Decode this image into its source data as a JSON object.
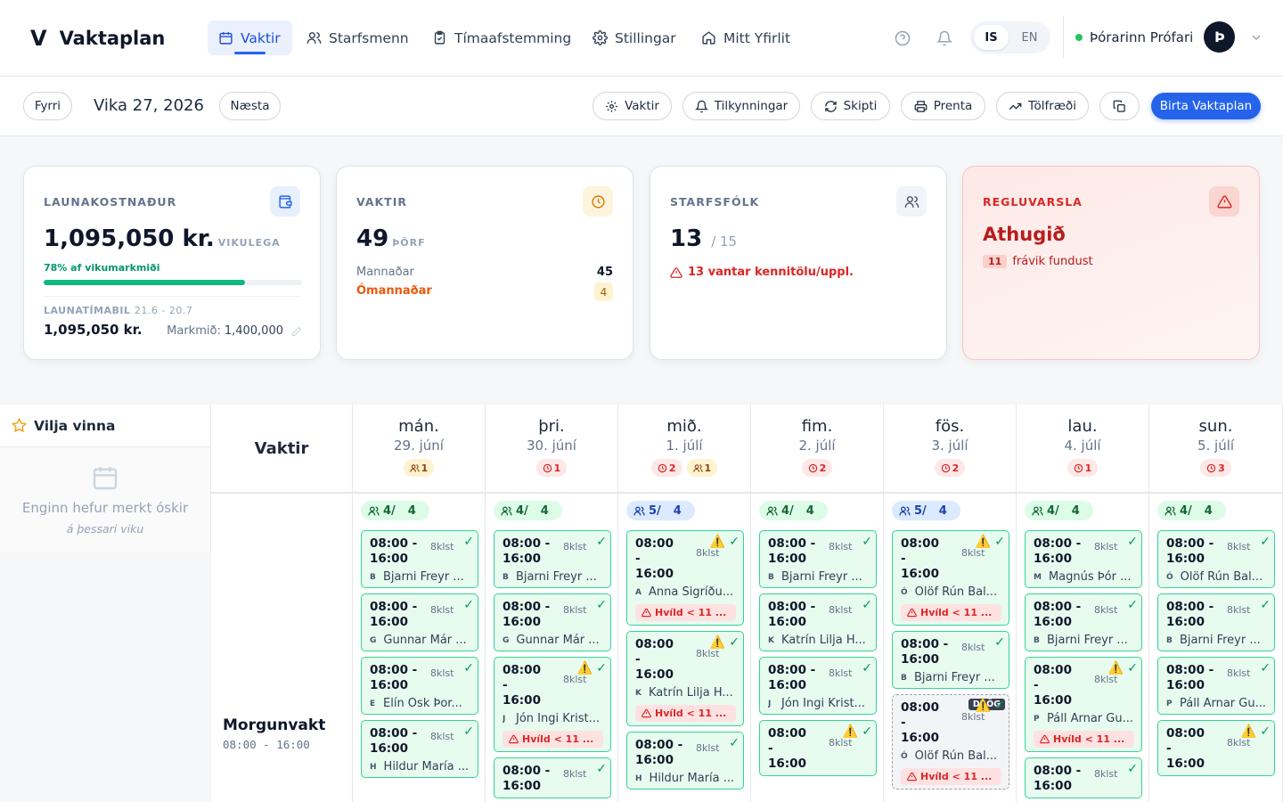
{
  "app": {
    "logo_mark": "V",
    "title": "Vaktaplan"
  },
  "nav": [
    {
      "label": "Vaktir",
      "icon": "calendar-icon",
      "active": true
    },
    {
      "label": "Starfsmenn",
      "icon": "users-icon",
      "active": false
    },
    {
      "label": "Tímaafstemming",
      "icon": "clipboard-check-icon",
      "active": false
    },
    {
      "label": "Stillingar",
      "icon": "gear-icon",
      "active": false
    },
    {
      "label": "Mitt Yfirlit",
      "icon": "home-icon",
      "active": false
    }
  ],
  "lang": {
    "is": "IS",
    "en": "EN"
  },
  "user": {
    "name": "Þórarinn Prófari",
    "initial": "Þ"
  },
  "toolbar": {
    "prev": "Fyrri",
    "week": "Vika 27, 2026",
    "next": "Næsta",
    "shifts": "Vaktir",
    "notifications": "Tilkynningar",
    "swaps": "Skipti",
    "print": "Prenta",
    "stats": "Tölfræði",
    "publish": "Birta Vaktaplan"
  },
  "cards": {
    "payroll": {
      "title": "LAUNAKOSTNAÐUR",
      "amount": "1,095,050 kr.",
      "unit": "VIKULEGA",
      "target_pct_text": "78% af vikumarkmiði",
      "progress": 0.78,
      "period_label": "LAUNATÍMABIL",
      "period_range": "21.6 - 20.7",
      "period_amount": "1,095,050 kr.",
      "target_label": "Markmið:",
      "target_value": "1,400,000"
    },
    "shifts": {
      "title": "VAKTIR",
      "count": "49",
      "unit": "ÞÖRF",
      "staffed_label": "Mannaðar",
      "staffed_value": "45",
      "unstaffed_label": "Ómannaðar",
      "unstaffed_value": "4"
    },
    "staff": {
      "title": "STARFSFÓLK",
      "count": "13",
      "total": "/ 15",
      "warning": "13 vantar kennitölu/uppl."
    },
    "compliance": {
      "title": "REGLUVARSLA",
      "heading": "Athugið",
      "count": "11",
      "text": "frávik fundust"
    }
  },
  "side": {
    "title": "Vilja vinna",
    "empty": "Enginn hefur merkt óskir",
    "empty_sub": "á þessari viku"
  },
  "grid": {
    "row_header": "Vaktir",
    "row_name": "Morgunvakt",
    "row_time": "08:00 - 16:00"
  },
  "days": [
    {
      "name": "mán.",
      "date": "29. júní",
      "badges": [
        {
          "type": "yel",
          "icon": "users-icon",
          "text": "1"
        }
      ],
      "count_a": "4/",
      "count_b": "4",
      "count_style": "g",
      "shifts": [
        {
          "time": "08:00 - 16:00",
          "hours": "8klst",
          "initial": "B",
          "person": "Bjarni Freyr ...",
          "warn": false,
          "alert": ""
        },
        {
          "time": "08:00 - 16:00",
          "hours": "8klst",
          "initial": "G",
          "person": "Gunnar Már ...",
          "warn": false,
          "alert": ""
        },
        {
          "time": "08:00 - 16:00",
          "hours": "8klst",
          "initial": "E",
          "person": "Elín Ósk Þor...",
          "warn": false,
          "alert": ""
        },
        {
          "time": "08:00 - 16:00",
          "hours": "8klst",
          "initial": "H",
          "person": "Hildur María ...",
          "warn": false,
          "alert": ""
        }
      ]
    },
    {
      "name": "þri.",
      "date": "30. júní",
      "badges": [
        {
          "type": "red",
          "icon": "clock-icon",
          "text": "1"
        }
      ],
      "count_a": "4/",
      "count_b": "4",
      "count_style": "g",
      "shifts": [
        {
          "time": "08:00 - 16:00",
          "hours": "8klst",
          "initial": "B",
          "person": "Bjarni Freyr ...",
          "warn": false,
          "alert": ""
        },
        {
          "time": "08:00 - 16:00",
          "hours": "8klst",
          "initial": "G",
          "person": "Gunnar Már ...",
          "warn": false,
          "alert": ""
        },
        {
          "time": "08:00 - 16:00",
          "hours": "8klst",
          "initial": "J",
          "person": "Jón Ingi Krist...",
          "warn": true,
          "alert": "Hvíld < 11 ..."
        },
        {
          "time": "08:00 - 16:00",
          "hours": "8klst",
          "initial": "",
          "person": "",
          "warn": false,
          "alert": ""
        }
      ]
    },
    {
      "name": "mið.",
      "date": "1. júlí",
      "badges": [
        {
          "type": "red",
          "icon": "clock-icon",
          "text": "2"
        },
        {
          "type": "yel",
          "icon": "users-icon",
          "text": "1"
        }
      ],
      "count_a": "5/",
      "count_b": "4",
      "count_style": "b",
      "shifts": [
        {
          "time": "08:00 - 16:00",
          "hours": "8klst",
          "initial": "A",
          "person": "Anna Sigríðu...",
          "warn": true,
          "alert": "Hvíld < 11 ..."
        },
        {
          "time": "08:00 - 16:00",
          "hours": "8klst",
          "initial": "K",
          "person": "Katrín Lilja H...",
          "warn": true,
          "alert": "Hvíld < 11 ..."
        },
        {
          "time": "08:00 - 16:00",
          "hours": "8klst",
          "initial": "H",
          "person": "Hildur María ...",
          "warn": false,
          "alert": ""
        }
      ]
    },
    {
      "name": "fim.",
      "date": "2. júlí",
      "badges": [
        {
          "type": "red",
          "icon": "clock-icon",
          "text": "2"
        }
      ],
      "count_a": "4/",
      "count_b": "4",
      "count_style": "g",
      "shifts": [
        {
          "time": "08:00 - 16:00",
          "hours": "8klst",
          "initial": "B",
          "person": "Bjarni Freyr ...",
          "warn": false,
          "alert": ""
        },
        {
          "time": "08:00 - 16:00",
          "hours": "8klst",
          "initial": "K",
          "person": "Katrín Lilja H...",
          "warn": false,
          "alert": ""
        },
        {
          "time": "08:00 - 16:00",
          "hours": "8klst",
          "initial": "J",
          "person": "Jón Ingi Krist...",
          "warn": false,
          "alert": ""
        },
        {
          "time": "08:00 - 16:00",
          "hours": "8klst",
          "initial": "",
          "person": "",
          "warn": true,
          "alert": ""
        }
      ]
    },
    {
      "name": "fös.",
      "date": "3. júlí",
      "badges": [
        {
          "type": "red",
          "icon": "clock-icon",
          "text": "2"
        }
      ],
      "count_a": "5/",
      "count_b": "4",
      "count_style": "b",
      "shifts": [
        {
          "time": "08:00 - 16:00",
          "hours": "8klst",
          "initial": "Ó",
          "person": "Ólöf Rún Bal...",
          "warn": true,
          "alert": "Hvíld < 11 ..."
        },
        {
          "time": "08:00 - 16:00",
          "hours": "8klst",
          "initial": "B",
          "person": "Bjarni Freyr ...",
          "warn": false,
          "alert": ""
        },
        {
          "time": "08:00 - 16:00",
          "hours": "8klst",
          "initial": "Ó",
          "person": "Ólöf Rún Bal...",
          "warn": true,
          "alert": "Hvíld < 11 ...",
          "draft": "DRÖG"
        }
      ]
    },
    {
      "name": "lau.",
      "date": "4. júlí",
      "badges": [
        {
          "type": "red",
          "icon": "clock-icon",
          "text": "1"
        }
      ],
      "count_a": "4/",
      "count_b": "4",
      "count_style": "g",
      "shifts": [
        {
          "time": "08:00 - 16:00",
          "hours": "8klst",
          "initial": "M",
          "person": "Magnús Þór ...",
          "warn": false,
          "alert": ""
        },
        {
          "time": "08:00 - 16:00",
          "hours": "8klst",
          "initial": "B",
          "person": "Bjarni Freyr ...",
          "warn": false,
          "alert": ""
        },
        {
          "time": "08:00 - 16:00",
          "hours": "8klst",
          "initial": "P",
          "person": "Páll Arnar Gu...",
          "warn": true,
          "alert": "Hvíld < 11 ..."
        },
        {
          "time": "08:00 - 16:00",
          "hours": "8klst",
          "initial": "",
          "person": "",
          "warn": false,
          "alert": ""
        }
      ]
    },
    {
      "name": "sun.",
      "date": "5. júlí",
      "badges": [
        {
          "type": "red",
          "icon": "clock-icon",
          "text": "3"
        }
      ],
      "count_a": "4/",
      "count_b": "4",
      "count_style": "g",
      "shifts": [
        {
          "time": "08:00 - 16:00",
          "hours": "8klst",
          "initial": "Ó",
          "person": "Ólöf Rún Bal...",
          "warn": false,
          "alert": ""
        },
        {
          "time": "08:00 - 16:00",
          "hours": "8klst",
          "initial": "B",
          "person": "Bjarni Freyr ...",
          "warn": false,
          "alert": ""
        },
        {
          "time": "08:00 - 16:00",
          "hours": "8klst",
          "initial": "P",
          "person": "Páll Arnar Gu...",
          "warn": false,
          "alert": ""
        },
        {
          "time": "08:00 - 16:00",
          "hours": "8klst",
          "initial": "",
          "person": "",
          "warn": true,
          "alert": ""
        }
      ]
    }
  ]
}
